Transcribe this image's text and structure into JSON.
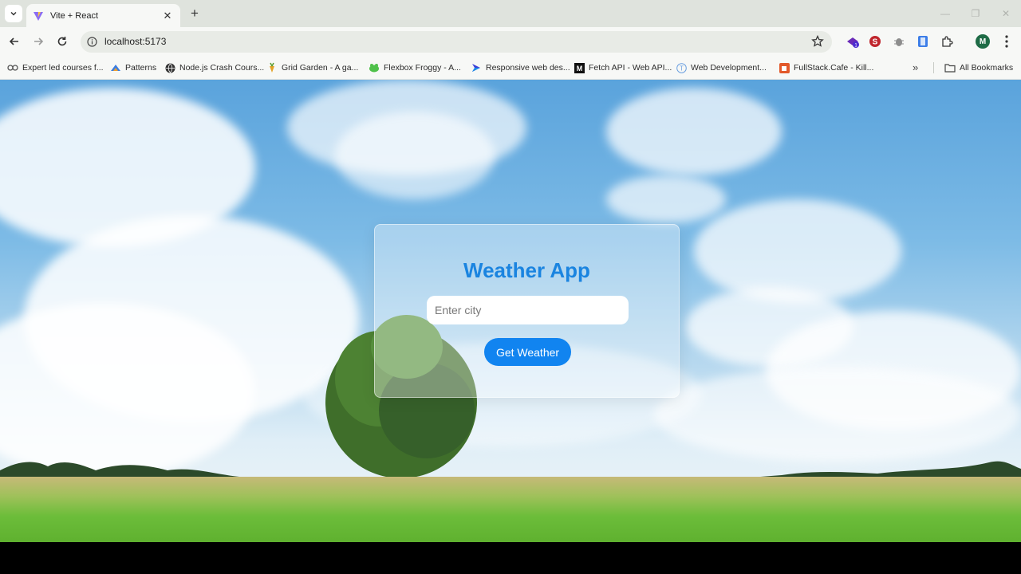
{
  "browser": {
    "tab": {
      "title": "Vite + React"
    },
    "address": {
      "url": "localhost:5173"
    },
    "profile_initial": "M",
    "bookmarks": [
      {
        "label": "Expert led courses f...",
        "icon": "glasses-icon"
      },
      {
        "label": "Patterns",
        "icon": "patterns-icon"
      },
      {
        "label": "Node.js Crash Cours...",
        "icon": "globe-icon"
      },
      {
        "label": "Grid Garden - A ga...",
        "icon": "carrot-icon"
      },
      {
        "label": "Flexbox Froggy - A...",
        "icon": "frog-icon"
      },
      {
        "label": "Responsive web des...",
        "icon": "arrow-logo-icon"
      },
      {
        "label": "Fetch API - Web API...",
        "icon": "mdn-icon"
      },
      {
        "label": "Web Development...",
        "icon": "info-circle-icon"
      },
      {
        "label": "FullStack.Cafe - Kill...",
        "icon": "cafe-icon"
      }
    ],
    "all_bookmarks_label": "All Bookmarks"
  },
  "app": {
    "title": "Weather App",
    "city_input": {
      "value": "",
      "placeholder": "Enter city"
    },
    "button_label": "Get Weather",
    "colors": {
      "title": "#1a84e0",
      "button": "#1184f0"
    }
  }
}
